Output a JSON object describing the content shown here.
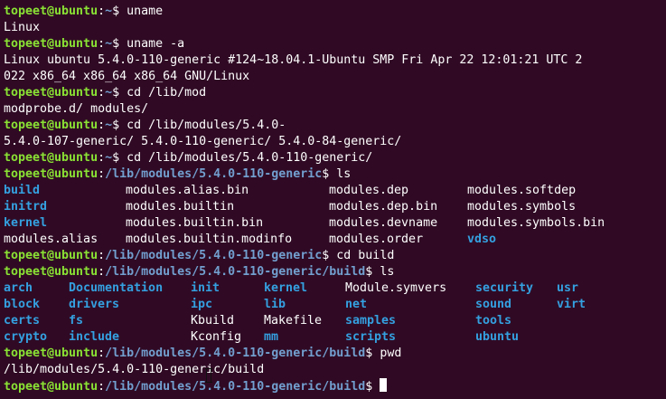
{
  "prompt": {
    "user_host": "topeet@ubuntu",
    "colon": ":",
    "dollar": "$ ",
    "path_home": "~",
    "path_modules": "/lib/modules/5.4.0-110-generic",
    "path_build": "/lib/modules/5.4.0-110-generic/build"
  },
  "lines": [
    {
      "cmd": "uname"
    },
    {
      "out": "Linux"
    },
    {
      "cmd": "uname -a"
    },
    {
      "out": "Linux ubuntu 5.4.0-110-generic #124~18.04.1-Ubuntu SMP Fri Apr 22 12:01:21 UTC 2"
    },
    {
      "out": "022 x86_64 x86_64 x86_64 GNU/Linux"
    },
    {
      "cmd": "cd /lib/mod"
    },
    {
      "out": "modprobe.d/ modules/"
    },
    {
      "cmd": "cd /lib/modules/5.4.0-"
    },
    {
      "out": "5.4.0-107-generic/ 5.4.0-110-generic/ 5.4.0-84-generic/"
    },
    {
      "cmd": "cd /lib/modules/5.4.0-110-generic/"
    },
    {
      "cmd_modules": "ls"
    }
  ],
  "ls_modules": [
    [
      "build",
      "modules.alias.bin",
      "modules.dep",
      "modules.softdep"
    ],
    [
      "initrd",
      "modules.builtin",
      "modules.dep.bin",
      "modules.symbols"
    ],
    [
      "kernel",
      "modules.builtin.bin",
      "modules.devname",
      "modules.symbols.bin"
    ],
    [
      "modules.alias",
      "modules.builtin.modinfo",
      "modules.order",
      "vdso"
    ]
  ],
  "ls_modules_dirs": [
    "build",
    "initrd",
    "kernel",
    "vdso"
  ],
  "after_ls1": [
    {
      "cmd_modules": "cd build"
    },
    {
      "cmd_build": "ls"
    }
  ],
  "ls_build": [
    [
      "arch",
      "Documentation",
      "init",
      "kernel",
      "Module.symvers",
      "security",
      "usr"
    ],
    [
      "block",
      "drivers",
      "ipc",
      "lib",
      "net",
      "sound",
      "virt"
    ],
    [
      "certs",
      "fs",
      "Kbuild",
      "Makefile",
      "samples",
      "tools",
      ""
    ],
    [
      "crypto",
      "include",
      "Kconfig",
      "mm",
      "scripts",
      "ubuntu",
      ""
    ]
  ],
  "ls_build_files": [
    "Kbuild",
    "Makefile",
    "Kconfig",
    "Module.symvers"
  ],
  "after_ls2": [
    {
      "cmd_build": "pwd"
    },
    {
      "out": "/lib/modules/5.4.0-110-generic/build"
    },
    {
      "cmd_build": ""
    }
  ],
  "colors": {
    "background": "#300a24",
    "user": "#8ae234",
    "path": "#729fcf",
    "text": "#ffffff",
    "directory": "#34a0e0"
  }
}
